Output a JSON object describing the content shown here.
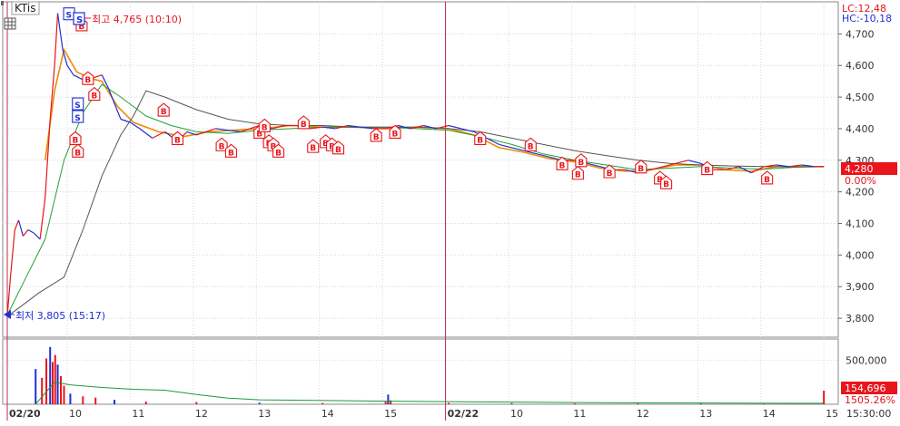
{
  "window": {
    "title": "KTis",
    "grid_icon": "grid-icon",
    "restore_icon": "restore-icon"
  },
  "indicators": {
    "lc": "LC:12,48",
    "hc": "HC:-10,18"
  },
  "annotations": {
    "high": {
      "marker": "S",
      "text": "최고 4,765 (10:10)",
      "value": 4765
    },
    "low": {
      "text": "최저 3,805 (15:17)",
      "value": 3805
    }
  },
  "current": {
    "price_label": "4,280",
    "price": 4280,
    "change_label": "0.00%",
    "volume_label": "154,696",
    "volume_change_label": "1505.26%"
  },
  "colors": {
    "up": "#e8151b",
    "down": "#1d2fd6",
    "ma_short": "#ef8c00",
    "ma_mid": "#23a033",
    "ma_long": "#555555",
    "ma_vol": "#1a9a3a",
    "grid": "#d8d8d8",
    "divider": "#c0284a",
    "label_bg": "#e8151b",
    "axis_text": "#333333"
  },
  "chart_data": {
    "type": "line",
    "x_labels": [
      "02/20",
      "10",
      "11",
      "12",
      "13",
      "14",
      "15",
      "02/22",
      "10",
      "11",
      "12",
      "13",
      "14",
      "15",
      "15:30:00"
    ],
    "price_axis": {
      "ylim": [
        3740,
        4790
      ],
      "ticks": [
        3800,
        3900,
        4000,
        4100,
        4200,
        4300,
        4400,
        4500,
        4600,
        4700
      ],
      "tick_labels": [
        "3,800",
        "3,900",
        "4,000",
        "4,100",
        "4,200",
        "4,300",
        "4,400",
        "4,500",
        "4,600",
        "4,700"
      ]
    },
    "volume_axis": {
      "ticks": [
        500000
      ],
      "tick_labels": [
        "500,000"
      ]
    },
    "price_path": [
      [
        0,
        3805
      ],
      [
        0.05,
        3930
      ],
      [
        0.12,
        4080
      ],
      [
        0.18,
        4110
      ],
      [
        0.25,
        4060
      ],
      [
        0.33,
        4080
      ],
      [
        0.42,
        4070
      ],
      [
        0.52,
        4050
      ],
      [
        0.6,
        4180
      ],
      [
        0.68,
        4430
      ],
      [
        0.75,
        4600
      ],
      [
        0.8,
        4765
      ],
      [
        0.88,
        4650
      ],
      [
        0.95,
        4600
      ],
      [
        1.05,
        4570
      ],
      [
        1.15,
        4560
      ],
      [
        1.25,
        4550
      ],
      [
        1.35,
        4560
      ],
      [
        1.5,
        4570
      ],
      [
        1.6,
        4530
      ],
      [
        1.7,
        4480
      ],
      [
        1.8,
        4430
      ],
      [
        1.95,
        4420
      ],
      [
        2.1,
        4400
      ],
      [
        2.3,
        4370
      ],
      [
        2.5,
        4390
      ],
      [
        2.7,
        4360
      ],
      [
        2.85,
        4390
      ],
      [
        3.0,
        4380
      ],
      [
        3.15,
        4390
      ],
      [
        3.3,
        4400
      ],
      [
        3.5,
        4395
      ],
      [
        3.7,
        4390
      ],
      [
        3.85,
        4400
      ],
      [
        4.0,
        4410
      ],
      [
        4.2,
        4400
      ],
      [
        4.4,
        4410
      ],
      [
        4.6,
        4410
      ],
      [
        4.8,
        4400
      ],
      [
        5.0,
        4405
      ],
      [
        5.2,
        4400
      ],
      [
        5.4,
        4410
      ],
      [
        5.6,
        4405
      ],
      [
        5.8,
        4400
      ],
      [
        6.0,
        4400
      ],
      [
        6.2,
        4410
      ],
      [
        6.4,
        4400
      ],
      [
        6.6,
        4410
      ],
      [
        6.8,
        4400
      ],
      [
        7.0,
        4410
      ],
      [
        7.2,
        4400
      ],
      [
        7.4,
        4390
      ],
      [
        7.6,
        4370
      ],
      [
        7.8,
        4350
      ],
      [
        8.0,
        4340
      ],
      [
        8.2,
        4330
      ],
      [
        8.4,
        4320
      ],
      [
        8.6,
        4310
      ],
      [
        8.8,
        4300
      ],
      [
        9.0,
        4300
      ],
      [
        9.2,
        4290
      ],
      [
        9.4,
        4280
      ],
      [
        9.6,
        4270
      ],
      [
        9.8,
        4270
      ],
      [
        10.0,
        4260
      ],
      [
        10.2,
        4270
      ],
      [
        10.4,
        4280
      ],
      [
        10.6,
        4290
      ],
      [
        10.8,
        4300
      ],
      [
        11.0,
        4290
      ],
      [
        11.2,
        4270
      ],
      [
        11.4,
        4270
      ],
      [
        11.6,
        4280
      ],
      [
        11.8,
        4260
      ],
      [
        12.0,
        4280
      ],
      [
        12.2,
        4285
      ],
      [
        12.4,
        4280
      ],
      [
        12.6,
        4285
      ],
      [
        12.8,
        4280
      ],
      [
        12.95,
        4280
      ]
    ],
    "series": [
      {
        "values": [
          [
            0.6,
            4300
          ],
          [
            0.75,
            4520
          ],
          [
            0.9,
            4650
          ],
          [
            1.1,
            4580
          ],
          [
            1.3,
            4560
          ],
          [
            1.5,
            4550
          ],
          [
            1.75,
            4470
          ],
          [
            2.0,
            4420
          ],
          [
            2.4,
            4390
          ],
          [
            2.8,
            4375
          ],
          [
            3.2,
            4390
          ],
          [
            3.6,
            4395
          ],
          [
            4.0,
            4400
          ],
          [
            4.5,
            4410
          ],
          [
            5.0,
            4405
          ],
          [
            5.5,
            4405
          ],
          [
            6.0,
            4400
          ],
          [
            6.5,
            4405
          ],
          [
            7.0,
            4400
          ],
          [
            7.4,
            4380
          ],
          [
            7.8,
            4340
          ],
          [
            8.2,
            4325
          ],
          [
            8.6,
            4305
          ],
          [
            9.0,
            4295
          ],
          [
            9.4,
            4275
          ],
          [
            9.8,
            4265
          ],
          [
            10.2,
            4270
          ],
          [
            10.6,
            4285
          ],
          [
            11.0,
            4285
          ],
          [
            11.4,
            4270
          ],
          [
            11.8,
            4265
          ],
          [
            12.2,
            4280
          ],
          [
            12.6,
            4280
          ],
          [
            12.95,
            4280
          ]
        ]
      },
      {
        "values": [
          [
            0,
            3810
          ],
          [
            0.3,
            3930
          ],
          [
            0.6,
            4050
          ],
          [
            0.9,
            4300
          ],
          [
            1.2,
            4450
          ],
          [
            1.5,
            4540
          ],
          [
            1.8,
            4500
          ],
          [
            2.2,
            4440
          ],
          [
            2.6,
            4410
          ],
          [
            3.0,
            4390
          ],
          [
            3.5,
            4385
          ],
          [
            4.0,
            4395
          ],
          [
            4.5,
            4400
          ],
          [
            5.0,
            4405
          ],
          [
            5.5,
            4405
          ],
          [
            6.0,
            4405
          ],
          [
            6.5,
            4400
          ],
          [
            7.0,
            4395
          ],
          [
            7.5,
            4375
          ],
          [
            8.0,
            4350
          ],
          [
            8.5,
            4320
          ],
          [
            9.0,
            4300
          ],
          [
            9.5,
            4285
          ],
          [
            10.0,
            4270
          ],
          [
            10.5,
            4275
          ],
          [
            11.0,
            4280
          ],
          [
            11.5,
            4275
          ],
          [
            12.0,
            4272
          ],
          [
            12.5,
            4278
          ],
          [
            12.95,
            4280
          ]
        ]
      },
      {
        "values": [
          [
            0,
            3805
          ],
          [
            0.5,
            3880
          ],
          [
            0.9,
            3930
          ],
          [
            1.2,
            4080
          ],
          [
            1.5,
            4250
          ],
          [
            1.8,
            4380
          ],
          [
            2.0,
            4440
          ],
          [
            2.2,
            4520
          ],
          [
            2.5,
            4500
          ],
          [
            3.0,
            4460
          ],
          [
            3.5,
            4430
          ],
          [
            4.0,
            4415
          ],
          [
            4.5,
            4410
          ],
          [
            5.0,
            4410
          ],
          [
            5.5,
            4405
          ],
          [
            6.0,
            4405
          ],
          [
            6.5,
            4405
          ],
          [
            7.0,
            4400
          ],
          [
            7.5,
            4390
          ],
          [
            8.0,
            4370
          ],
          [
            8.5,
            4350
          ],
          [
            9.0,
            4330
          ],
          [
            9.5,
            4315
          ],
          [
            10.0,
            4300
          ],
          [
            10.5,
            4290
          ],
          [
            11.0,
            4285
          ],
          [
            11.5,
            4282
          ],
          [
            12.0,
            4280
          ],
          [
            12.5,
            4279
          ],
          [
            12.95,
            4280
          ]
        ]
      }
    ],
    "markers": [
      {
        "type": "S",
        "x": 0.98,
        "y": 4765
      },
      {
        "type": "S",
        "x": 1.12,
        "y": 4480
      },
      {
        "type": "S",
        "x": 1.12,
        "y": 4440
      },
      {
        "type": "B",
        "x": 1.18,
        "y": 4730
      },
      {
        "type": "B",
        "x": 1.28,
        "y": 4560
      },
      {
        "type": "B",
        "x": 1.38,
        "y": 4510
      },
      {
        "type": "B",
        "x": 1.08,
        "y": 4370
      },
      {
        "type": "B",
        "x": 1.12,
        "y": 4330
      },
      {
        "type": "B",
        "x": 2.48,
        "y": 4460
      },
      {
        "type": "B",
        "x": 2.7,
        "y": 4370
      },
      {
        "type": "B",
        "x": 3.4,
        "y": 4350
      },
      {
        "type": "B",
        "x": 3.55,
        "y": 4330
      },
      {
        "type": "B",
        "x": 4.0,
        "y": 4390
      },
      {
        "type": "B",
        "x": 4.08,
        "y": 4410
      },
      {
        "type": "B",
        "x": 4.15,
        "y": 4360
      },
      {
        "type": "B",
        "x": 4.22,
        "y": 4350
      },
      {
        "type": "B",
        "x": 4.3,
        "y": 4330
      },
      {
        "type": "B",
        "x": 4.7,
        "y": 4420
      },
      {
        "type": "B",
        "x": 4.85,
        "y": 4345
      },
      {
        "type": "B",
        "x": 5.05,
        "y": 4360
      },
      {
        "type": "B",
        "x": 5.15,
        "y": 4350
      },
      {
        "type": "B",
        "x": 5.25,
        "y": 4340
      },
      {
        "type": "B",
        "x": 5.85,
        "y": 4380
      },
      {
        "type": "B",
        "x": 6.15,
        "y": 4390
      },
      {
        "type": "B",
        "x": 7.5,
        "y": 4370
      },
      {
        "type": "B",
        "x": 8.3,
        "y": 4350
      },
      {
        "type": "B",
        "x": 8.8,
        "y": 4290
      },
      {
        "type": "B",
        "x": 9.05,
        "y": 4260
      },
      {
        "type": "B",
        "x": 9.1,
        "y": 4300
      },
      {
        "type": "B",
        "x": 9.55,
        "y": 4265
      },
      {
        "type": "B",
        "x": 10.05,
        "y": 4280
      },
      {
        "type": "B",
        "x": 10.35,
        "y": 4245
      },
      {
        "type": "B",
        "x": 10.45,
        "y": 4230
      },
      {
        "type": "B",
        "x": 11.1,
        "y": 4275
      },
      {
        "type": "B",
        "x": 12.05,
        "y": 4245
      }
    ],
    "volume": [
      [
        0.45,
        400000
      ],
      [
        0.55,
        300000
      ],
      [
        0.62,
        520000
      ],
      [
        0.68,
        650000
      ],
      [
        0.72,
        480000
      ],
      [
        0.76,
        560000
      ],
      [
        0.8,
        450000
      ],
      [
        0.85,
        320000
      ],
      [
        0.9,
        210000
      ],
      [
        1.0,
        120000
      ],
      [
        1.2,
        90000
      ],
      [
        1.4,
        75000
      ],
      [
        1.7,
        50000
      ],
      [
        2.2,
        30000
      ],
      [
        3.0,
        25000
      ],
      [
        4.0,
        18000
      ],
      [
        5.0,
        15000
      ],
      [
        6.0,
        30000
      ],
      [
        6.04,
        110000
      ],
      [
        6.08,
        45000
      ],
      [
        7.0,
        15000
      ],
      [
        8.0,
        12000
      ],
      [
        9.0,
        10000
      ],
      [
        10.0,
        9000
      ],
      [
        11.0,
        8000
      ],
      [
        12.0,
        6000
      ],
      [
        12.95,
        154696
      ]
    ],
    "volume_ma": [
      [
        0.45,
        0
      ],
      [
        0.75,
        250000
      ],
      [
        1.0,
        220000
      ],
      [
        1.5,
        190000
      ],
      [
        2.0,
        170000
      ],
      [
        2.5,
        160000
      ],
      [
        3.0,
        110000
      ],
      [
        3.5,
        70000
      ],
      [
        4.0,
        50000
      ],
      [
        6.0,
        35000
      ],
      [
        8.0,
        25000
      ],
      [
        10.0,
        15000
      ],
      [
        12.95,
        10000
      ]
    ]
  }
}
